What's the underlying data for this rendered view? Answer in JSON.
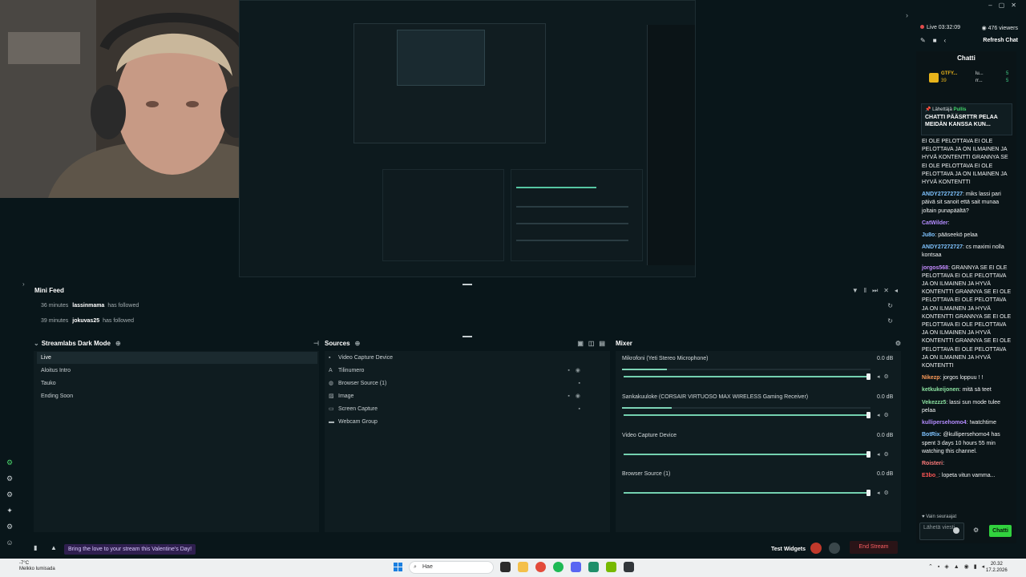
{
  "stream": {
    "live_label": "Live 03:32:09",
    "viewers": "476 viewers",
    "refresh_chat": "Refresh Chat"
  },
  "mini_feed": {
    "title": "Mini Feed",
    "events": [
      {
        "time": "36 minutes",
        "user": "lassinmama",
        "action": "has followed"
      },
      {
        "time": "39 minutes",
        "user": "jokuvas25",
        "action": "has followed"
      }
    ]
  },
  "scenes": {
    "title": "Streamlabs Dark Mode",
    "items": [
      "Live",
      "Aloitus Intro",
      "Tauko",
      "Ending Soon"
    ]
  },
  "sources": {
    "title": "Sources",
    "items": [
      {
        "label": "Video Capture Device",
        "icon": "camera-icon"
      },
      {
        "label": "Tilinumero",
        "icon": "text-icon"
      },
      {
        "label": "Browser Source (1)",
        "icon": "globe-icon"
      },
      {
        "label": "Image",
        "icon": "image-icon"
      },
      {
        "label": "Screen Capture",
        "icon": "monitor-icon"
      },
      {
        "label": "Webcam Group",
        "icon": "folder-icon"
      }
    ]
  },
  "mixer": {
    "title": "Mixer",
    "channels": [
      {
        "name": "Mikrofoni (Yeti Stereo Microphone)",
        "db": "0.0 dB",
        "level": 0.18,
        "fader": 1.0
      },
      {
        "name": "Sankakuuloke (CORSAIR VIRTUOSO MAX WIRELESS Gaming Receiver)",
        "db": "0.0 dB",
        "level": 0.2,
        "fader": 1.0
      },
      {
        "name": "Video Capture Device",
        "db": "0.0 dB",
        "level": 0.0,
        "fader": 1.0
      },
      {
        "name": "Browser Source (1)",
        "db": "0.0 dB",
        "level": 0.0,
        "fader": 1.0
      }
    ]
  },
  "status_bar": {
    "valentine": "Bring the love to your stream this Valentine's Day!",
    "test_widgets": "Test Widgets",
    "end_stream": "End Stream"
  },
  "chat": {
    "title": "Chatti",
    "hype_left": "GTFY...",
    "hype_left_count": "39",
    "hype_right": "lu...",
    "hype_right_2": "rr...",
    "hype_right_count": "5",
    "pinned_by_prefix": "Lähettäjä",
    "pinned_by": "Pullis",
    "pinned_message": "CHATTI PÄÄSRTTR PELAA MEIDÄN KANSSA KUN...",
    "messages": [
      {
        "user": "",
        "color": "#ffffff",
        "text": "EI OLE PELOTTAVA EI OLE PELOTTAVA JA ON ILMAINEN JA HYVÄ KONTENTTI GRANNYA SE EI OLE PELOTTAVA EI OLE PELOTTAVA JA ON ILMAINEN JA HYVÄ KONTENTTI"
      },
      {
        "user": "ANDY27272727",
        "color": "#7fc3ff",
        "text": "miks lassi pari päivä sit sanoit että sait munaa joltain punapäältä?"
      },
      {
        "user": "CatWilder",
        "color": "#b48cff",
        "text": ""
      },
      {
        "user": "Ju8o",
        "color": "#7fc3ff",
        "text": "pääseekö pelaa"
      },
      {
        "user": "ANDY27272727",
        "color": "#7fc3ff",
        "text": "cs maximi nolla kontsaa"
      },
      {
        "user": "jorgos568",
        "color": "#c58cff",
        "text": "GRANNYA SE EI OLE PELOTTAVA EI OLE PELOTTAVA JA ON ILMAINEN JA HYVÄ KONTENTTI GRANNYA SE EI OLE PELOTTAVA EI OLE PELOTTAVA JA ON ILMAINEN JA HYVÄ KONTENTTI GRANNYA SE EI OLE PELOTTAVA EI OLE PELOTTAVA JA ON ILMAINEN JA HYVÄ KONTENTTI GRANNYA SE EI OLE PELOTTAVA EI OLE PELOTTAVA JA ON ILMAINEN JA HYVÄ KONTENTTI"
      },
      {
        "user": "Nikezp",
        "color": "#ff9c5a",
        "text": "jorgos loppuu ! !"
      },
      {
        "user": "ketkukeijonen",
        "color": "#8be0a0",
        "text": "mitä sä teet"
      },
      {
        "user": "Vekezzz5",
        "color": "#8be0a0",
        "text": "lassi sun mode tulee pelaa"
      },
      {
        "user": "kullipersehomo4",
        "color": "#b48cff",
        "text": "!watchtime"
      },
      {
        "user": "BotRix",
        "color": "#7fc3ff",
        "text": "@kullipersehomo4 has spent 3 days 10 hours 55 min watching this channel."
      },
      {
        "user": "Roisteri",
        "color": "#ff7b7b",
        "text": ""
      },
      {
        "user": "E3bo_",
        "color": "#ff5656",
        "text": "lopeta vitun vamma..."
      }
    ],
    "followers_only": "Vain seuraajat",
    "input_placeholder": "Lähetä viesti",
    "send_label": "Chatti"
  },
  "taskbar": {
    "weather_temp": "-7°C",
    "weather_desc": "Melkko lumisada",
    "search_placeholder": "Hae",
    "time": "20.32",
    "date": "17.2.2026"
  }
}
